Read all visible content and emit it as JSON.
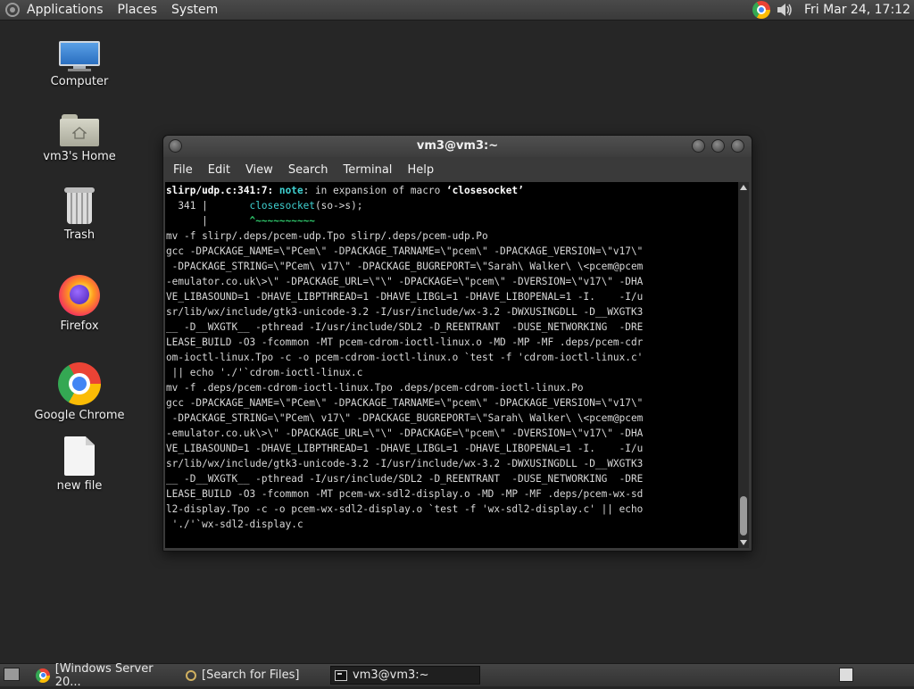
{
  "top_panel": {
    "menus": [
      "Applications",
      "Places",
      "System"
    ],
    "clock": "Fri Mar 24, 17:12",
    "tray_icons": [
      "chrome-icon",
      "volume-icon"
    ]
  },
  "desktop": {
    "icons": [
      {
        "label": "Computer",
        "icon": "computer-icon"
      },
      {
        "label": "vm3's Home",
        "icon": "home-folder-icon"
      },
      {
        "label": "Trash",
        "icon": "trash-icon"
      },
      {
        "label": "Firefox",
        "icon": "firefox-icon"
      },
      {
        "label": "Google Chrome",
        "icon": "chrome-icon"
      },
      {
        "label": "new file",
        "icon": "file-icon"
      }
    ]
  },
  "terminal": {
    "title": "vm3@vm3:~",
    "menu": [
      "File",
      "Edit",
      "View",
      "Search",
      "Terminal",
      "Help"
    ],
    "note_loc": "slirp/udp.c:341:7:",
    "note_label": "note",
    "note_text": ": in expansion of macro ",
    "note_macro": "‘closesocket’",
    "src_lineno": "  341 |",
    "src_code": "       closesocket",
    "src_rest": "(so->s);",
    "src_marker_bar": "      |",
    "src_marker": "       ^~~~~~~~~~~",
    "lines": [
      "mv -f slirp/.deps/pcem-udp.Tpo slirp/.deps/pcem-udp.Po",
      "gcc -DPACKAGE_NAME=\\\"PCem\\\" -DPACKAGE_TARNAME=\\\"pcem\\\" -DPACKAGE_VERSION=\\\"v17\\\"",
      " -DPACKAGE_STRING=\\\"PCem\\ v17\\\" -DPACKAGE_BUGREPORT=\\\"Sarah\\ Walker\\ \\<pcem@pcem",
      "-emulator.co.uk\\>\\\" -DPACKAGE_URL=\\\"\\\" -DPACKAGE=\\\"pcem\\\" -DVERSION=\\\"v17\\\" -DHA",
      "VE_LIBASOUND=1 -DHAVE_LIBPTHREAD=1 -DHAVE_LIBGL=1 -DHAVE_LIBOPENAL=1 -I.    -I/u",
      "sr/lib/wx/include/gtk3-unicode-3.2 -I/usr/include/wx-3.2 -DWXUSINGDLL -D__WXGTK3",
      "__ -D__WXGTK__ -pthread -I/usr/include/SDL2 -D_REENTRANT  -DUSE_NETWORKING  -DRE",
      "LEASE_BUILD -O3 -fcommon -MT pcem-cdrom-ioctl-linux.o -MD -MP -MF .deps/pcem-cdr",
      "om-ioctl-linux.Tpo -c -o pcem-cdrom-ioctl-linux.o `test -f 'cdrom-ioctl-linux.c'",
      " || echo './'`cdrom-ioctl-linux.c",
      "mv -f .deps/pcem-cdrom-ioctl-linux.Tpo .deps/pcem-cdrom-ioctl-linux.Po",
      "gcc -DPACKAGE_NAME=\\\"PCem\\\" -DPACKAGE_TARNAME=\\\"pcem\\\" -DPACKAGE_VERSION=\\\"v17\\\"",
      " -DPACKAGE_STRING=\\\"PCem\\ v17\\\" -DPACKAGE_BUGREPORT=\\\"Sarah\\ Walker\\ \\<pcem@pcem",
      "-emulator.co.uk\\>\\\" -DPACKAGE_URL=\\\"\\\" -DPACKAGE=\\\"pcem\\\" -DVERSION=\\\"v17\\\" -DHA",
      "VE_LIBASOUND=1 -DHAVE_LIBPTHREAD=1 -DHAVE_LIBGL=1 -DHAVE_LIBOPENAL=1 -I.    -I/u",
      "sr/lib/wx/include/gtk3-unicode-3.2 -I/usr/include/wx-3.2 -DWXUSINGDLL -D__WXGTK3",
      "__ -D__WXGTK__ -pthread -I/usr/include/SDL2 -D_REENTRANT  -DUSE_NETWORKING  -DRE",
      "LEASE_BUILD -O3 -fcommon -MT pcem-wx-sdl2-display.o -MD -MP -MF .deps/pcem-wx-sd",
      "l2-display.Tpo -c -o pcem-wx-sdl2-display.o `test -f 'wx-sdl2-display.c' || echo",
      " './'`wx-sdl2-display.c"
    ]
  },
  "taskbar": {
    "tasks": [
      {
        "label": "[Windows Server 20...",
        "icon": "chrome-icon"
      },
      {
        "label": "[Search for Files]",
        "icon": "search-icon"
      },
      {
        "label": "vm3@vm3:~",
        "icon": "terminal-icon"
      }
    ]
  },
  "colors": {
    "desktop_bg": "#262626",
    "panel_bg": "#3f3f3f",
    "terminal_bg": "#000000",
    "note_cyan": "#3fd0d0",
    "marker_green": "#2ec46a"
  }
}
